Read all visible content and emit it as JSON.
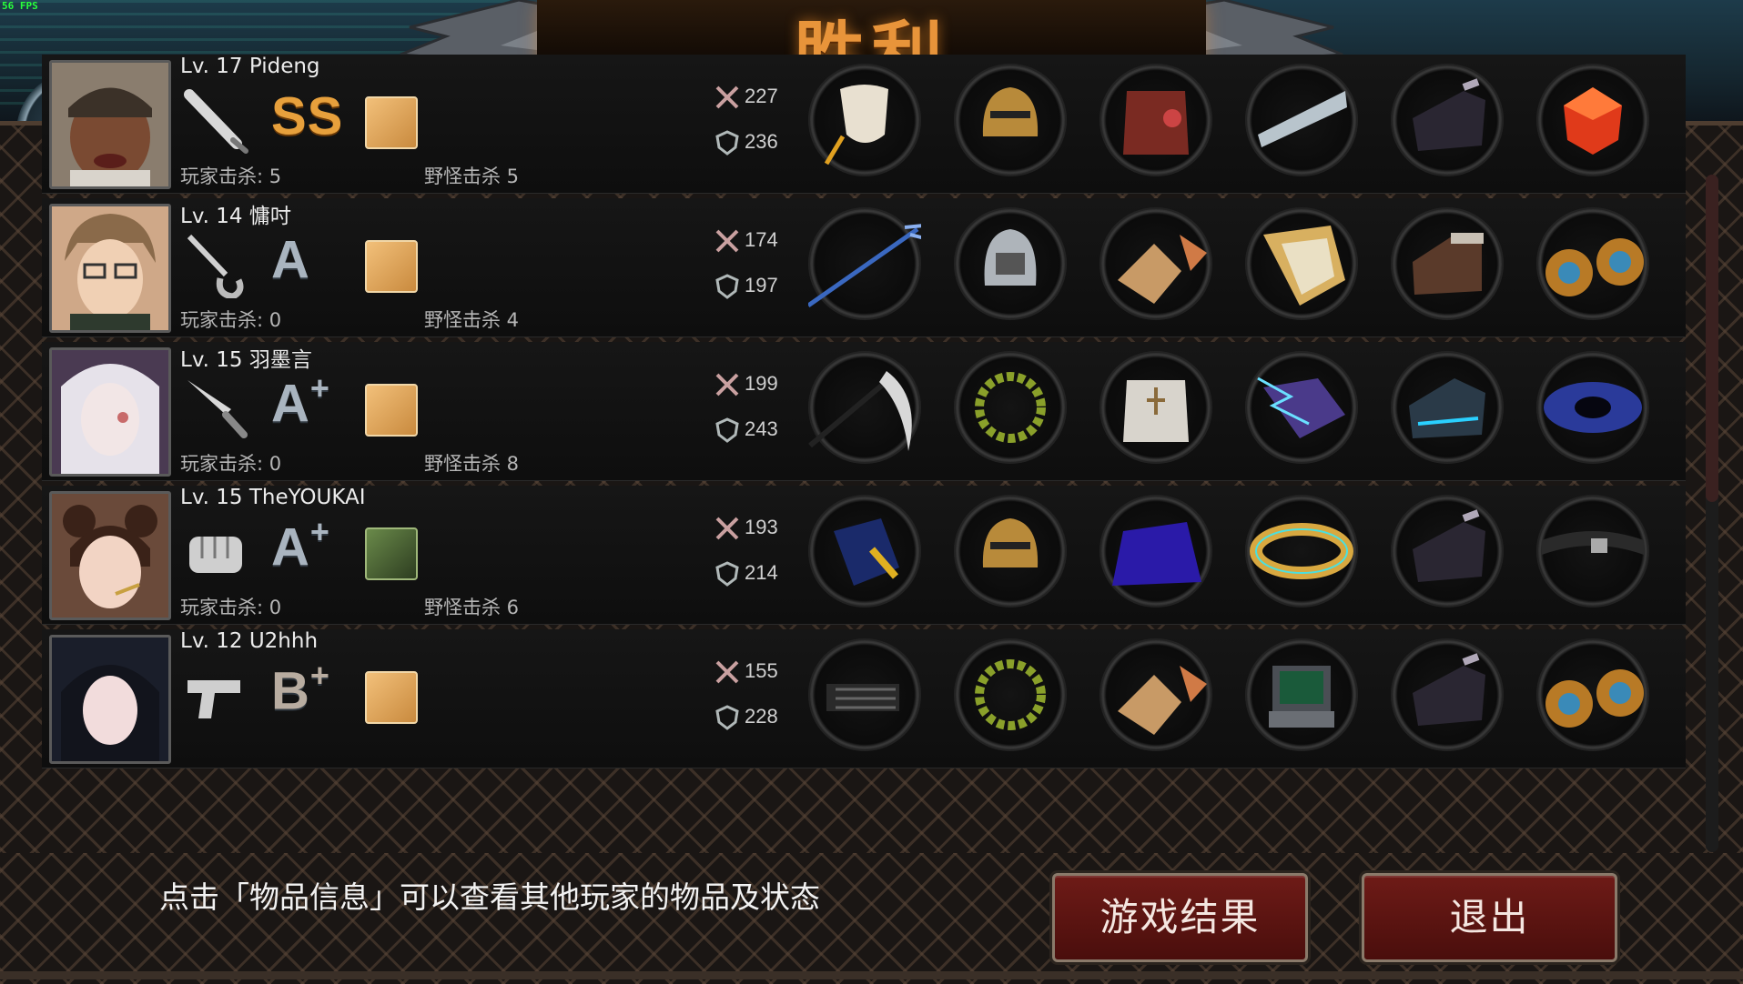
{
  "fps": "56 FPS",
  "title": "胜利",
  "players": [
    {
      "level_name": "Lv. 17  Pideng",
      "grade": "SS",
      "grade_plus": "",
      "weapon": "bat-icon",
      "player_kills": "玩家击杀: 5",
      "monster_kills": "野怪击杀 5",
      "attack": "227",
      "defense": "236",
      "items": [
        "white-cloak-icon",
        "gold-helmet-icon",
        "red-armor-icon",
        "steel-arm-guard-icon",
        "dark-boots-icon",
        "red-dice-icon"
      ]
    },
    {
      "level_name": "Lv. 14  慵吋",
      "grade": "A",
      "grade_plus": "",
      "weapon": "curved-blade-icon",
      "player_kills": "玩家击杀: 0",
      "monster_kills": "野怪击杀 4",
      "attack": "174",
      "defense": "197",
      "items": [
        "blue-trident-icon",
        "silver-helmet-icon",
        "scale-gauntlet-icon",
        "gold-shield-icon",
        "brown-boots-icon",
        "sapphire-earrings-icon"
      ]
    },
    {
      "level_name": "Lv. 15  羽墨言",
      "grade": "A",
      "grade_plus": "+",
      "weapon": "knife-icon",
      "player_kills": "玩家击杀: 0",
      "monster_kills": "野怪击杀 8",
      "attack": "199",
      "defense": "243",
      "items": [
        "black-scythe-icon",
        "laurel-wreath-icon",
        "white-plate-armor-icon",
        "lightning-gauntlet-icon",
        "tech-boots-icon",
        "galaxy-ring-icon"
      ]
    },
    {
      "level_name": "Lv. 15  TheYOUKAI",
      "grade": "A",
      "grade_plus": "+",
      "weapon": "fist-icon",
      "player_kills": "玩家击杀: 0",
      "monster_kills": "野怪击杀 6",
      "attack": "193",
      "defense": "214",
      "items": [
        "blue-glove-icon",
        "gold-helmet-icon",
        "purple-robe-icon",
        "gold-bracelet-icon",
        "dark-boots-icon",
        "black-belt-icon"
      ]
    },
    {
      "level_name": "Lv. 12  U2hhh",
      "grade": "B",
      "grade_plus": "+",
      "weapon": "pistol-icon",
      "player_kills": "",
      "monster_kills": "",
      "attack": "155",
      "defense": "228",
      "items": [
        "minigun-icon",
        "laurel-wreath-icon",
        "scale-gauntlet-icon",
        "radar-device-icon",
        "dark-boots-icon",
        "sapphire-earrings-icon"
      ]
    }
  ],
  "hint": "点击「物品信息」可以查看其他玩家的物品及状态",
  "buttons": {
    "result": "游戏结果",
    "exit": "退出"
  },
  "colors": {
    "victory": "#e8943a",
    "button": "#6e1b17"
  }
}
